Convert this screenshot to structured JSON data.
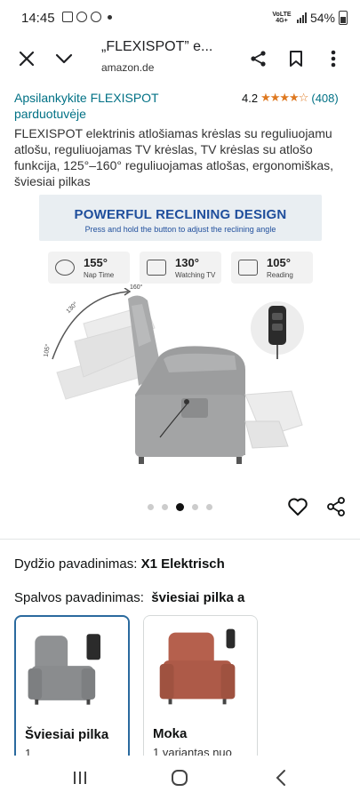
{
  "status_bar": {
    "time": "14:45",
    "network": "VoLTE 4G+",
    "battery": "54%"
  },
  "browser": {
    "title": "„FLEXISPOT” e...",
    "url": "amazon.de"
  },
  "product": {
    "store_link": "Apsilankykite FLEXISPOT parduotuvėje",
    "rating": "4.2",
    "stars": "★★★★☆",
    "rating_count": "(408)",
    "title": "FLEXISPOT elektrinis atlošiamas krėslas su reguliuojamu atlošu, reguliuojamas TV krėslas, TV krėslas su atlošo funkcija, 125°–160° reguliuojamas atlošas, ergonomiškas, šviesiai pilkas"
  },
  "hero": {
    "heading": "POWERFUL RECLINING DESIGN",
    "subheading": "Press and hold the button to adjust the reclining angle",
    "modes": [
      {
        "degree": "155°",
        "label": "Nap Time"
      },
      {
        "degree": "130°",
        "label": "Watching TV"
      },
      {
        "degree": "105°",
        "label": "Reading"
      }
    ],
    "angle_labels": [
      "160°",
      "130°",
      "105°"
    ],
    "dot_count": 5,
    "active_dot": 3
  },
  "variants": {
    "size_label": "Dydžio pavadinimas:",
    "size_value": "X1 Elektrisch",
    "color_label": "Spalvos pavadinimas:",
    "color_value": "šviesiai pilka a",
    "options": [
      {
        "name": "Šviesiai pilka",
        "sub": "1 ...",
        "color": "#8f9193"
      },
      {
        "name": "Moka",
        "sub": "1 variantas nuo",
        "color": "#b5604d"
      }
    ]
  },
  "colors": {
    "link": "#007185",
    "star": "#de7921",
    "hero_heading": "#1f4e9c",
    "selected_border": "#2a6a9e"
  }
}
